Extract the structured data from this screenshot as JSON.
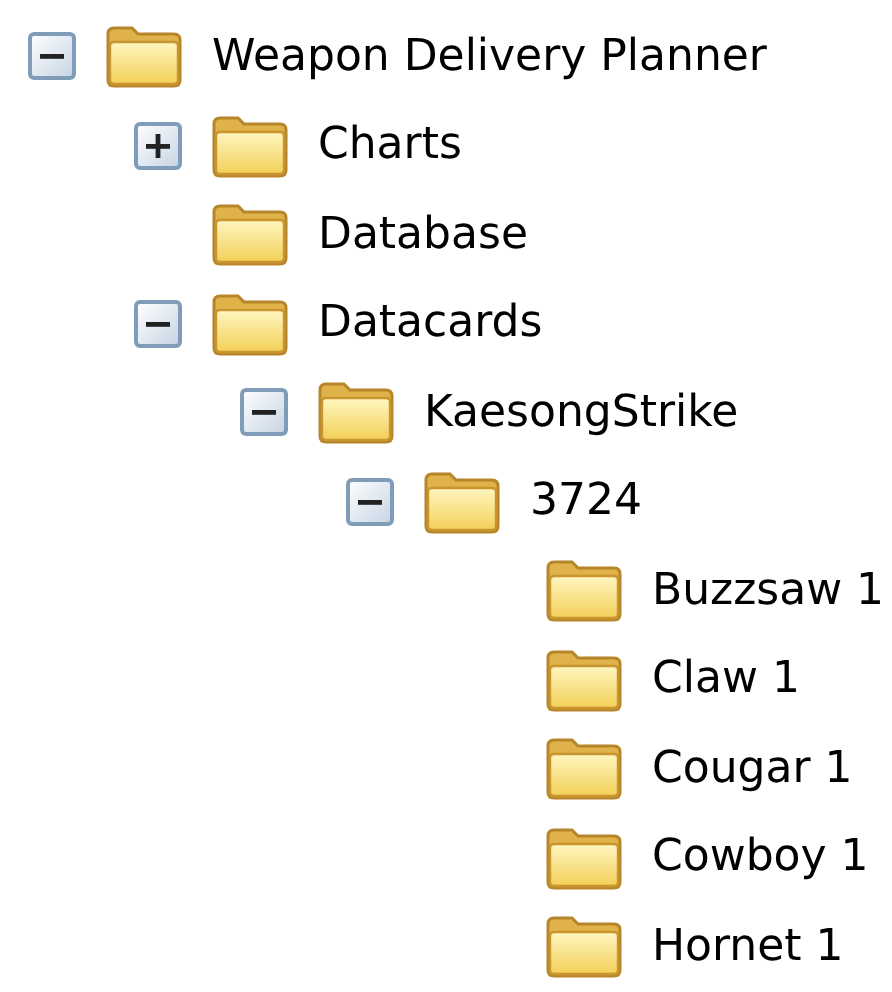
{
  "tree": [
    {
      "label": "Weapon Delivery Planner",
      "expanded": true,
      "children": [
        {
          "label": "Charts",
          "expanded": false
        },
        {
          "label": "Database"
        },
        {
          "label": "Datacards",
          "expanded": true,
          "children": [
            {
              "label": "KaesongStrike",
              "expanded": true,
              "children": [
                {
                  "label": "3724",
                  "expanded": true,
                  "children": [
                    {
                      "label": "Buzzsaw 1"
                    },
                    {
                      "label": "Claw 1"
                    },
                    {
                      "label": "Cougar 1"
                    },
                    {
                      "label": "Cowboy 1"
                    },
                    {
                      "label": "Hornet 1"
                    }
                  ]
                }
              ]
            }
          ]
        }
      ]
    }
  ]
}
